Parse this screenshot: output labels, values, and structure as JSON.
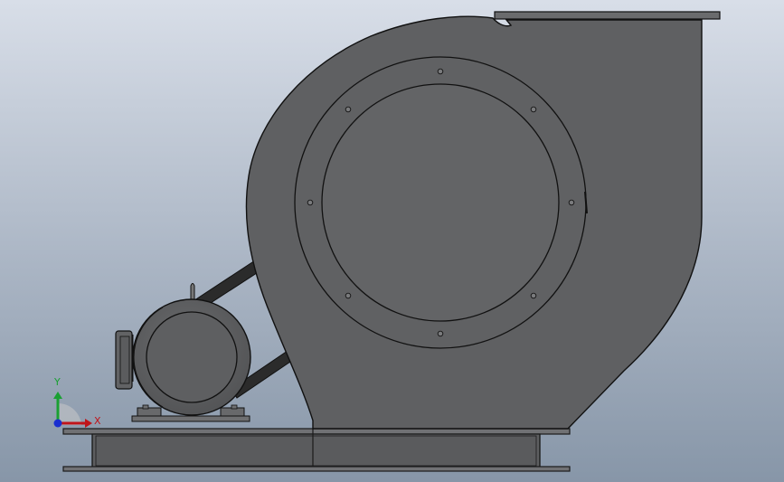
{
  "viewport": {
    "background_top": "#d5dbe6",
    "background_bottom": "#8e9cad"
  },
  "model": {
    "body_color": "#5f6062",
    "body_color_light": "#6b6c6e",
    "edge_color": "#1a1a1a",
    "belt_color": "#2b2b2b"
  },
  "triad": {
    "x_label": "X",
    "y_label": "Y",
    "x_color": "#c0141a",
    "y_color": "#1aa033",
    "z_color": "#1a2fd0"
  }
}
